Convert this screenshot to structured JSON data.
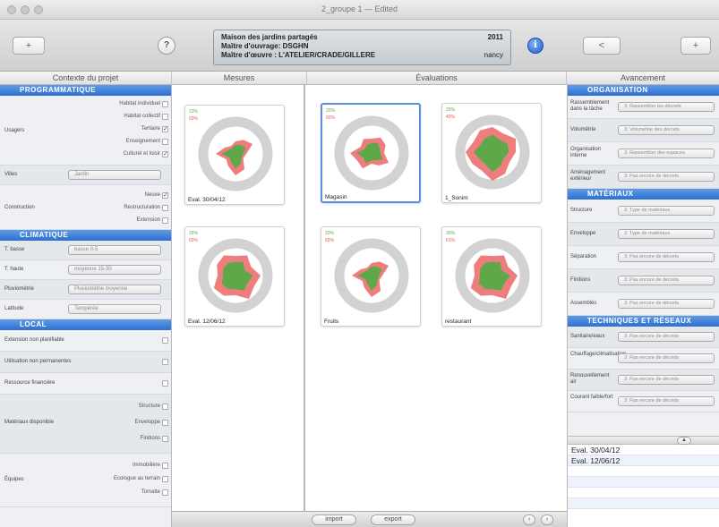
{
  "window": {
    "title": "2_groupe 1 — Edited"
  },
  "toolbar": {
    "add_label": "+",
    "help_label": "?",
    "info_label": "i",
    "nav_label": "<",
    "add_right_label": "+"
  },
  "project": {
    "name": "Maison des jardins partagés",
    "year": "2011",
    "maitre_ouvrage": "Maître d'ouvrage: DSGHN",
    "maitre_oeuvre": "Maître d'œuvre : L'ATELIER/CRADE/GILLERE",
    "city": "nancy"
  },
  "columns": {
    "contexte": "Contexte du projet",
    "mesures": "Mesures",
    "evaluations": "Évaluations",
    "avancement": "Avancement"
  },
  "left": {
    "programmatique": {
      "title": "PROGRAMMATIQUE",
      "usagers_label": "Usagers",
      "usagers_options": [
        "Habitat individuel",
        "Habitat collectif",
        "Tertiaire",
        "Enseignement",
        "Culturel et loisir"
      ],
      "villes_label": "Villes",
      "villes_value": "Jardin",
      "construction_label": "Construction",
      "construction_options": [
        "Neuve",
        "Restructuration",
        "Extension"
      ]
    },
    "climatique": {
      "title": "CLIMATIQUE",
      "t_basse_label": "T. basse",
      "t_basse_value": "basse 0-5",
      "t_haute_label": "T. haute",
      "t_haute_value": "moyenne 15-30",
      "pluviometrie_label": "Pluviométrie",
      "pluviometrie_value": "Pluviométrie moyenne",
      "latitude_label": "Latitude",
      "latitude_value": "Tempérée"
    },
    "local": {
      "title": "LOCAL",
      "rows": [
        "Extension non planifiable",
        "Utilisation non permanentes",
        "Ressource financière"
      ],
      "materiaux_label": "Matériaux disponible",
      "materiaux_options": [
        "Structure",
        "Enveloppe",
        "Finitions"
      ],
      "equipes_label": "Équipes",
      "equipes_options": [
        "Immobilière",
        "Ecologue au terrain",
        "Tomatte"
      ]
    }
  },
  "mesures": {
    "cards": [
      {
        "caption": "Eval. 30/04/12",
        "pct_top": "23%",
        "pct_bottom": "50%"
      },
      {
        "caption": "Eval. 12/06/12",
        "pct_top": "25%",
        "pct_bottom": "60%"
      }
    ]
  },
  "evaluations": {
    "cards": [
      {
        "caption": "Magasin",
        "pct_top": "20%",
        "pct_bottom": "60%"
      },
      {
        "caption": "1_Sonim",
        "pct_top": "25%",
        "pct_bottom": "40%"
      },
      {
        "caption": "Fruits",
        "pct_top": "20%",
        "pct_bottom": "65%"
      },
      {
        "caption": "restaurant",
        "pct_top": "30%",
        "pct_bottom": "61%"
      }
    ]
  },
  "bottom": {
    "import_label": "import",
    "export_label": "export"
  },
  "right": {
    "organisation": {
      "title": "ORGANISATION",
      "rows": [
        {
          "label": "Rassemblement dans la tâche",
          "value": "3: Rassembler les décrets"
        },
        {
          "label": "Volumétrie",
          "value": "3: Volumétrie des décrets"
        },
        {
          "label": "Organisation interne",
          "value": "3: Rassembler des espaces"
        },
        {
          "label": "Aménagement extérieur",
          "value": "3: Pas encore de décrets"
        }
      ]
    },
    "materiaux": {
      "title": "MATÉRIAUX",
      "rows": [
        {
          "label": "Structure",
          "value": "2: Type de matériaux"
        },
        {
          "label": "Enveloppe",
          "value": "2: Type de matériaux"
        },
        {
          "label": "Séparation",
          "value": "3: Pas encore de décrets"
        },
        {
          "label": "Finitions",
          "value": "3: Pas encore de décrets"
        },
        {
          "label": "Assemblés",
          "value": "3: Pas encore de décrets"
        }
      ]
    },
    "techniques": {
      "title": "TECHNIQUES ET RÉSEAUX",
      "rows": [
        {
          "label": "Sanitaire/eaux",
          "value": "3: Pas encore de décrets"
        },
        {
          "label": "Chauffage/climatisation",
          "value": "3: Pas encore de décrets"
        },
        {
          "label": "Renouvellement air",
          "value": "3: Pas encore de décrets"
        },
        {
          "label": "Courant faible/fort",
          "value": "3: Pas encore de décrets"
        }
      ]
    },
    "history_toggle": "▲",
    "history": [
      "Eval. 30/04/12",
      "Eval. 12/06/12"
    ]
  },
  "colors": {
    "section_blue": "#2f6fcf",
    "gray_ring": "#d2d2d2",
    "red_area": "#ee7d7d",
    "green_area": "#5fa84a",
    "pct_top": "#5fa84a",
    "pct_bottom": "#e65a5a",
    "selection": "#5b8fd8"
  }
}
